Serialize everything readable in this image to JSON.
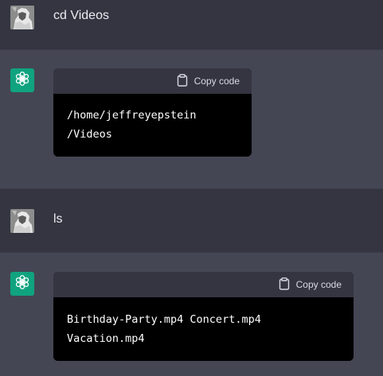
{
  "messages": [
    {
      "role": "user",
      "text": "cd Videos"
    },
    {
      "role": "assistant",
      "copy_label": "Copy code",
      "code_lines": [
        "/home/jeffreyepstein",
        "/Videos"
      ]
    },
    {
      "role": "user",
      "text": "ls"
    },
    {
      "role": "assistant",
      "copy_label": "Copy code",
      "code_lines": [
        "Birthday-Party.mp4 Concert.mp4",
        "Vacation.mp4"
      ]
    }
  ],
  "icons": {
    "assistant_avatar": "openai-logo-icon",
    "copy": "clipboard-icon"
  },
  "colors": {
    "assistant_bg": "#444654",
    "user_bg": "#343541",
    "avatar_green": "#10a37f",
    "code_bg": "#000000",
    "code_header_bg": "#343541"
  }
}
